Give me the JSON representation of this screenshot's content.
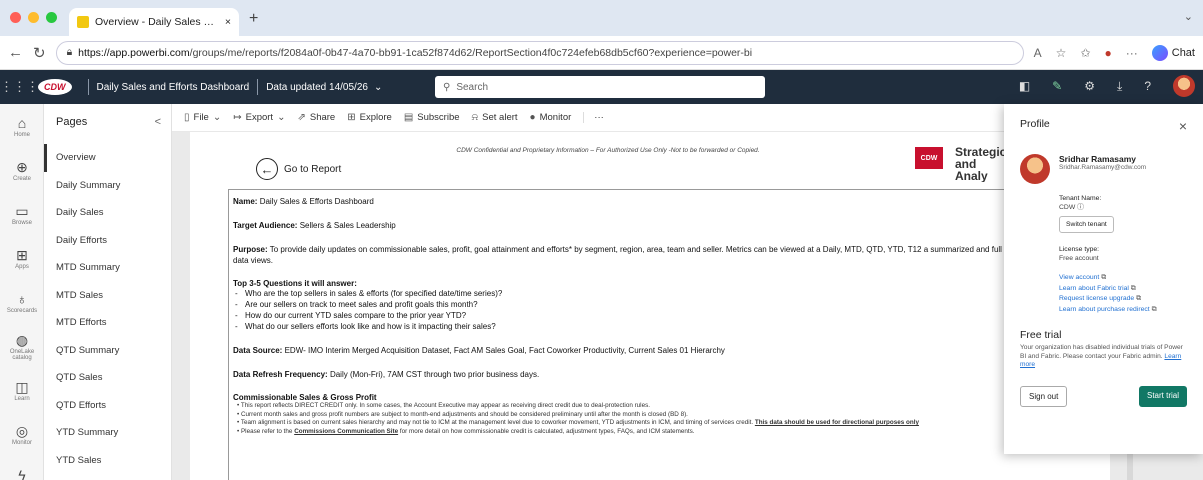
{
  "browser": {
    "tab_title": "Overview - Daily Sales and Effo",
    "new_tab": "+",
    "url_host": "https://app.powerbi.com",
    "url_path": "/groups/me/reports/f2084a0f-0b47-4a70-bb91-1ca52f874d62/ReportSection4f0c724efeb68db5cf60?experience=power-bi",
    "chat_label": "Chat"
  },
  "app": {
    "brand": "CDW",
    "report_title": "Daily Sales and Efforts Dashboard",
    "data_updated": "Data updated 14/05/26",
    "search_placeholder": "Search"
  },
  "rail": [
    {
      "icon": "home-icon",
      "glyph": "⌂",
      "label": "Home"
    },
    {
      "icon": "create-icon",
      "glyph": "⊕",
      "label": "Create"
    },
    {
      "icon": "browse-icon",
      "glyph": "▭",
      "label": "Browse"
    },
    {
      "icon": "apps-icon",
      "glyph": "⊞",
      "label": "Apps"
    },
    {
      "icon": "scorecards-icon",
      "glyph": "♁",
      "label": "Scorecards"
    },
    {
      "icon": "onelake-icon",
      "glyph": "◍",
      "label": "OneLake catalog"
    },
    {
      "icon": "learn-icon",
      "glyph": "◫",
      "label": "Learn"
    },
    {
      "icon": "monitor-icon",
      "glyph": "◎",
      "label": "Monitor"
    },
    {
      "icon": "realtime-icon",
      "glyph": "ϟ",
      "label": "Real-Time"
    }
  ],
  "pages": {
    "title": "Pages",
    "collapse": "<",
    "items": [
      "Overview",
      "Daily Summary",
      "Daily Sales",
      "Daily Efforts",
      "MTD Summary",
      "MTD Sales",
      "MTD Efforts",
      "QTD Summary",
      "QTD Sales",
      "QTD Efforts",
      "YTD Summary",
      "YTD Sales"
    ]
  },
  "toolbar": {
    "file": "File",
    "export": "Export",
    "share": "Share",
    "explore": "Explore",
    "subscribe": "Subscribe",
    "set_alert": "Set alert",
    "monitor": "Monitor",
    "more": "···"
  },
  "report": {
    "confidential": "CDW Confidential and Proprietary Information – For Authorized Use Only -Not to be forwarded or Copied.",
    "go_to_report": "Go to Report",
    "logo_text": "CDW",
    "strategic": "Strategic and Analy",
    "name_label": "Name:",
    "name_value": "Daily Sales & Efforts Dashboard",
    "audience_label": "Target Audience:",
    "audience_value": "Sellers & Sales Leadership",
    "purpose_label": "Purpose:",
    "purpose_value": "To provide daily updates on commissionable sales, profit, goal attainment and efforts* by segment, region, area, team and seller. Metrics can be viewed at a Daily, MTD, QTD, YTD, T12 a summarized and full data views.",
    "questions_label": "Top 3-5 Questions it will answer:",
    "questions": [
      "Who are the top sellers in sales & efforts (for specified date/time series)?",
      "Are our sellers on track to meet sales and profit goals this month?",
      "How do our current YTD sales compare to the prior year YTD?",
      "What do our sellers efforts look like and how is it impacting their sales?"
    ],
    "source_label": "Data Source:",
    "source_value": "EDW- IMO Interim Merged Acquisition Dataset, Fact AM Sales Goal, Fact Coworker Productivity, Current Sales 01 Hierarchy",
    "refresh_label": "Data Refresh Frequency:",
    "refresh_value": "Daily (Mon-Fri), 7AM CST through two prior business days.",
    "commission_label": "Commissionable Sales & Gross Profit",
    "notes": [
      "This report reflects DIRECT CREDIT only. In some cases, the Account Executive may appear as receiving direct credit due to deal-protection rules.",
      "Current month sales and gross profit numbers are subject to month-end adjustments and should be considered preliminary until after the month is closed (BD 8).",
      "Team alignment is based on current sales hierarchy and may not tie to ICM at the management level due to coworker movement, YTD adjustments in ICM, and timing of services credit."
    ],
    "directional_note": "This data should be used for directional purposes only",
    "last_note_pre": "Please refer to the",
    "last_note_link": "Commissions Communication Site",
    "last_note_post": "for more detail on how commissionable credit is calculated, adjustment types, FAQs, and ICM statements."
  },
  "profile": {
    "title": "Profile",
    "close": "×",
    "name": "Sridhar Ramasamy",
    "email": "Sridhar.Ramasamy@cdw.com",
    "tenant_label": "Tenant Name:",
    "tenant_value": "CDW ⓘ",
    "switch_tenant": "Switch tenant",
    "license_label": "License type:",
    "license_value": "Free account",
    "links": [
      "View account",
      "Learn about Fabric trial",
      "Request license upgrade",
      "Learn about purchase redirect"
    ],
    "trial_title": "Free trial",
    "trial_desc": "Your organization has disabled individual trials of Power BI and Fabric. Please contact your Fabric admin.",
    "learn_more": "Learn more",
    "sign_out": "Sign out",
    "start_trial": "Start trial"
  },
  "colors": {
    "appbar": "#1f2d3d",
    "accent_trial": "#117865",
    "cdw_red": "#c8102e"
  }
}
